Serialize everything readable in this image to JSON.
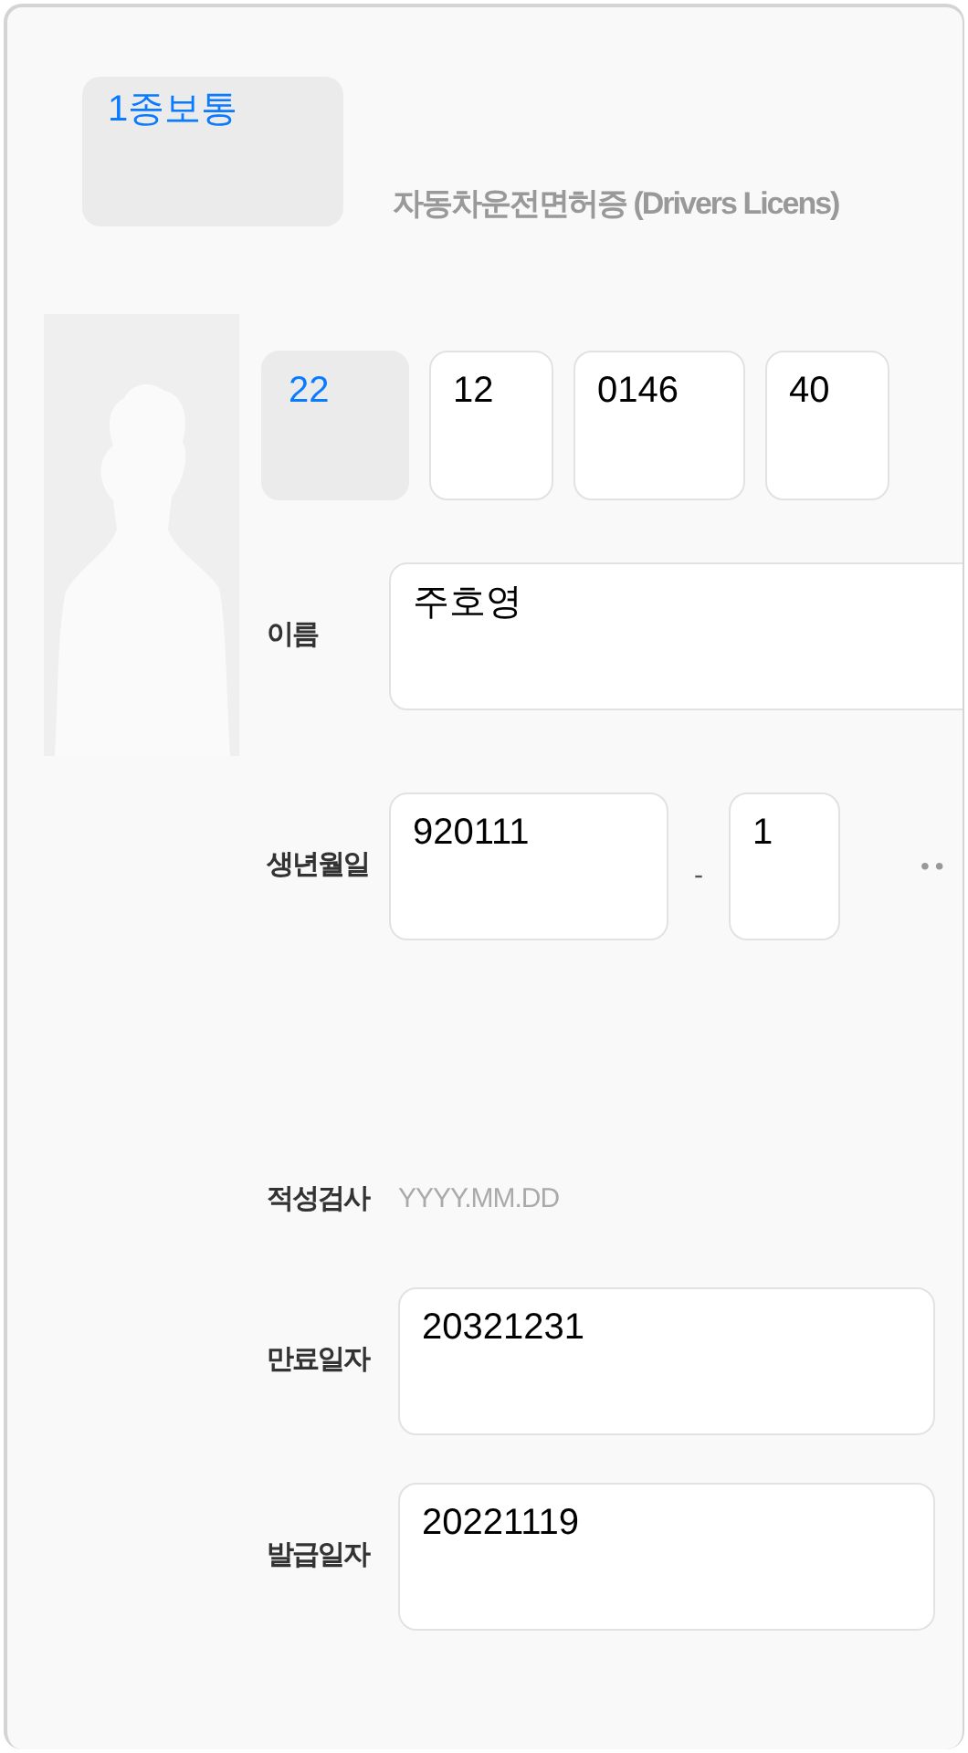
{
  "license_type": {
    "value": "1종보통"
  },
  "title": "자동차운전면허증 (Drivers Licens)",
  "license_number": [
    {
      "kind": "select",
      "value": "22"
    },
    {
      "kind": "input",
      "value": "12"
    },
    {
      "kind": "input",
      "value": "0146"
    },
    {
      "kind": "input",
      "value": "40"
    }
  ],
  "fields": [
    {
      "kind": "text",
      "label": "이름",
      "value": "주호영"
    },
    {
      "kind": "split",
      "label": "생년월일",
      "value": "920111",
      "separator": "-",
      "value_2": "1",
      "masked": "••"
    },
    {
      "kind": "plain",
      "label": "적성검사",
      "placeholder": "YYYY.MM.DD"
    },
    {
      "kind": "text",
      "label": "만료일자",
      "value": "20321231"
    },
    {
      "kind": "text",
      "label": "발급일자",
      "value": "20221119"
    }
  ]
}
